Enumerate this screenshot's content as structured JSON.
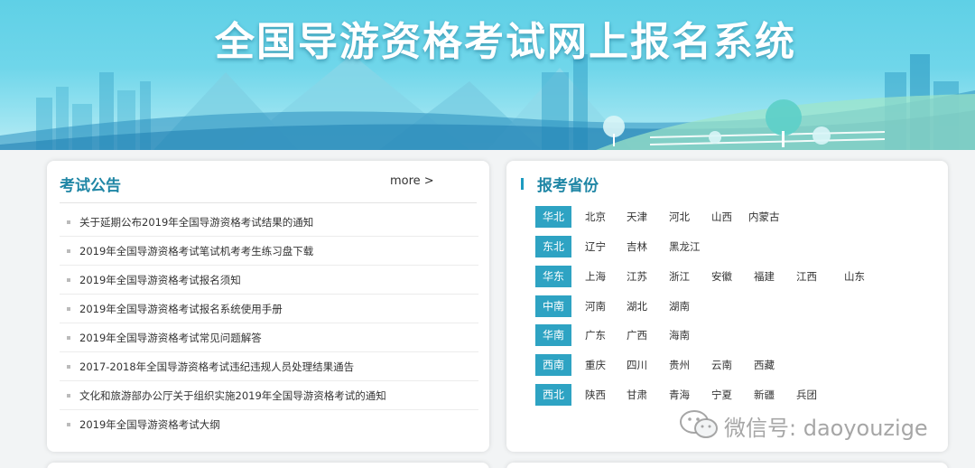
{
  "banner": {
    "title": "全国导游资格考试网上报名系统"
  },
  "notice": {
    "title": "考试公告",
    "more": "more >",
    "items": [
      "关于延期公布2019年全国导游资格考试结果的通知",
      "2019年全国导游资格考试笔试机考考生练习盘下载",
      "2019年全国导游资格考试报名须知",
      "2019年全国导游资格考试报名系统使用手册",
      "2019年全国导游资格考试常见问题解答",
      "2017-2018年全国导游资格考试违纪违规人员处理结果通告",
      "文化和旅游部办公厅关于组织实施2019年全国导游资格考试的通知",
      "2019年全国导游资格考试大纲"
    ]
  },
  "provinces": {
    "title": "报考省份",
    "regions": [
      {
        "name": "华北",
        "items": [
          "北京",
          "天津",
          "河北",
          "山西",
          "内蒙古"
        ]
      },
      {
        "name": "东北",
        "items": [
          "辽宁",
          "吉林",
          "黑龙江"
        ]
      },
      {
        "name": "华东",
        "items": [
          "上海",
          "江苏",
          "浙江",
          "安徽",
          "福建",
          "江西",
          "山东"
        ]
      },
      {
        "name": "中南",
        "items": [
          "河南",
          "湖北",
          "湖南"
        ]
      },
      {
        "name": "华南",
        "items": [
          "广东",
          "广西",
          "海南"
        ]
      },
      {
        "name": "西南",
        "items": [
          "重庆",
          "四川",
          "贵州",
          "云南",
          "西藏"
        ]
      },
      {
        "name": "西北",
        "items": [
          "陕西",
          "甘肃",
          "青海",
          "宁夏",
          "新疆",
          "兵团"
        ]
      }
    ]
  },
  "watermark": {
    "text": "微信号: daoyouzige",
    "icon": "wechat-icon"
  },
  "colors": {
    "accent": "#1f86a5",
    "badge": "#2ea3c3",
    "banner": "#6fd6ea"
  }
}
